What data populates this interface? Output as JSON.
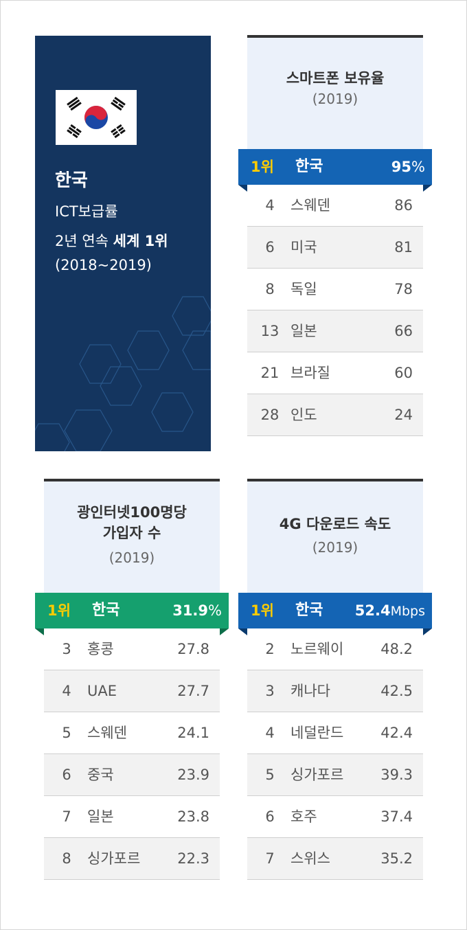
{
  "hero": {
    "country": "한국",
    "line1": "ICT보급률",
    "line2_prefix": "2년 연속 ",
    "line2_bold": "세계 1위",
    "line3": "(2018~2019)"
  },
  "colors": {
    "hero_bg": "#14355f",
    "panel_bg": "#ebf1fa",
    "blue_bar": "#1464b4",
    "blue_fold": "#0a3a6e",
    "green_bar": "#15a06e",
    "green_fold": "#0d6e4a",
    "rank_yellow": "#ffcc00"
  },
  "cards": {
    "smartphone": {
      "title": "스마트폰 보유율",
      "year": "(2019)",
      "top": {
        "rank": "1위",
        "name": "한국",
        "value": "95",
        "unit": "%"
      },
      "rows": [
        {
          "rank": "4",
          "name": "스웨덴",
          "value": "86"
        },
        {
          "rank": "6",
          "name": "미국",
          "value": "81"
        },
        {
          "rank": "8",
          "name": "독일",
          "value": "78"
        },
        {
          "rank": "13",
          "name": "일본",
          "value": "66"
        },
        {
          "rank": "21",
          "name": "브라질",
          "value": "60"
        },
        {
          "rank": "28",
          "name": "인도",
          "value": "24"
        }
      ]
    },
    "internet": {
      "title_line1": "광인터넷100명당",
      "title_line2": "가입자 수",
      "year": "(2019)",
      "top": {
        "rank": "1위",
        "name": "한국",
        "value": "31.9",
        "unit": "%"
      },
      "rows": [
        {
          "rank": "3",
          "name": "홍콩",
          "value": "27.8"
        },
        {
          "rank": "4",
          "name": "UAE",
          "value": "27.7"
        },
        {
          "rank": "5",
          "name": "스웨덴",
          "value": "24.1"
        },
        {
          "rank": "6",
          "name": "중국",
          "value": "23.9"
        },
        {
          "rank": "7",
          "name": "일본",
          "value": "23.8"
        },
        {
          "rank": "8",
          "name": "싱가포르",
          "value": "22.3"
        }
      ]
    },
    "download": {
      "title": "4G 다운로드 속도",
      "year": "(2019)",
      "top": {
        "rank": "1위",
        "name": "한국",
        "value": "52.4",
        "unit": "Mbps"
      },
      "rows": [
        {
          "rank": "2",
          "name": "노르웨이",
          "value": "48.2"
        },
        {
          "rank": "3",
          "name": "캐나다",
          "value": "42.5"
        },
        {
          "rank": "4",
          "name": "네덜란드",
          "value": "42.4"
        },
        {
          "rank": "5",
          "name": "싱가포르",
          "value": "39.3"
        },
        {
          "rank": "6",
          "name": "호주",
          "value": "37.4"
        },
        {
          "rank": "7",
          "name": "스위스",
          "value": "35.2"
        }
      ]
    }
  }
}
